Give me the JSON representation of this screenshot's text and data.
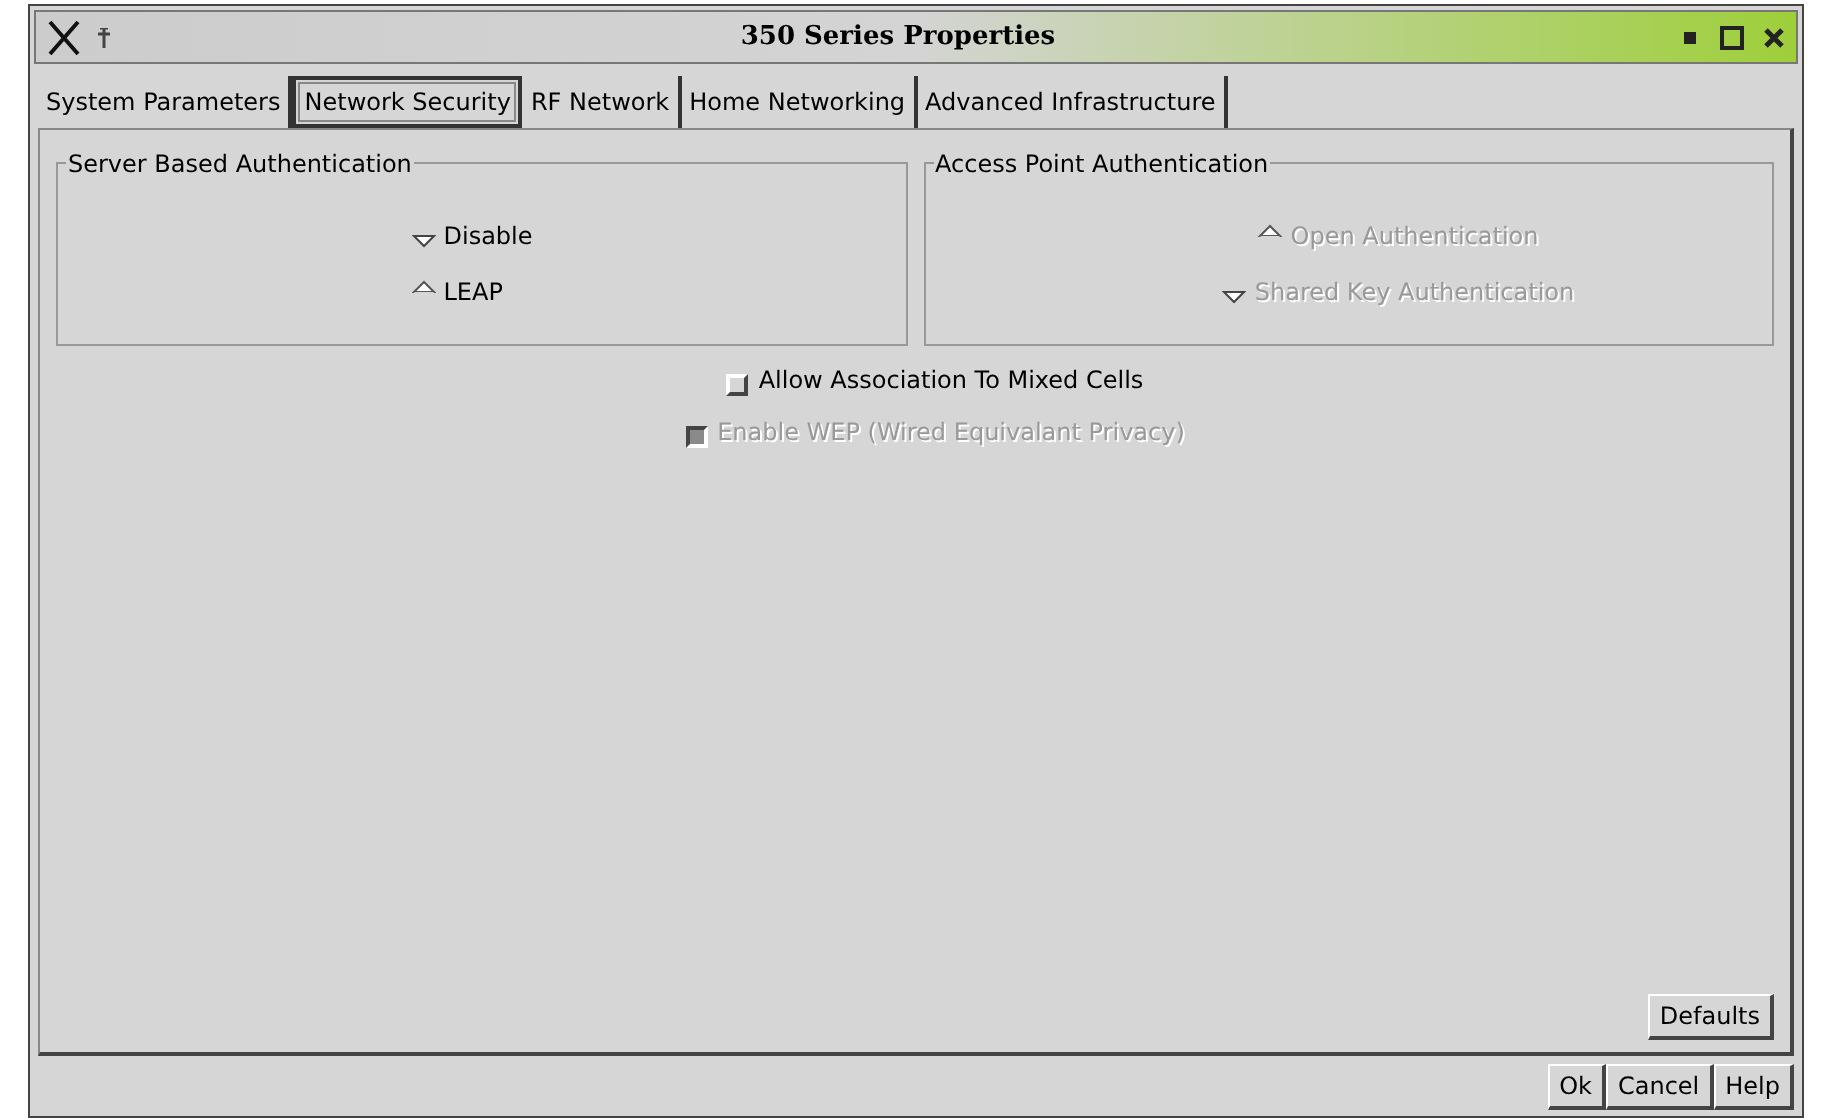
{
  "window": {
    "title": "350 Series Properties"
  },
  "tabs": [
    {
      "label": "System Parameters",
      "selected": false
    },
    {
      "label": "Network Security",
      "selected": true
    },
    {
      "label": "RF Network",
      "selected": false
    },
    {
      "label": "Home Networking",
      "selected": false
    },
    {
      "label": "Advanced Infrastructure",
      "selected": false
    }
  ],
  "groups": [
    {
      "title": "Server Based Authentication",
      "options": [
        {
          "label": "Disable",
          "selected": false,
          "disabled": false
        },
        {
          "label": "LEAP",
          "selected": true,
          "disabled": false
        }
      ]
    },
    {
      "title": "Access Point Authentication",
      "options": [
        {
          "label": "Open Authentication",
          "selected": true,
          "disabled": true
        },
        {
          "label": "Shared Key Authentication",
          "selected": false,
          "disabled": true
        }
      ]
    }
  ],
  "checkboxes": [
    {
      "label": "Allow Association To Mixed Cells",
      "checked": false,
      "disabled": false
    },
    {
      "label": "Enable WEP (Wired Equivalant Privacy)",
      "checked": true,
      "disabled": true
    }
  ],
  "panel_buttons": [
    "Defaults"
  ],
  "buttons": [
    "Ok",
    "Cancel",
    "Help"
  ]
}
